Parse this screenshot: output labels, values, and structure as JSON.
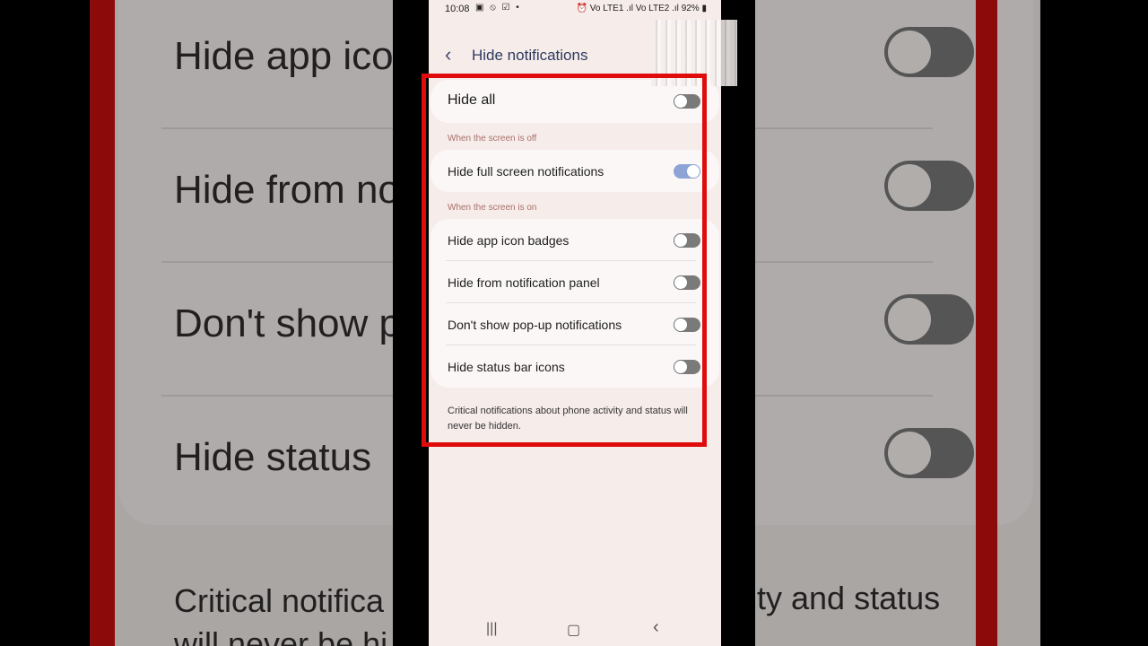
{
  "background_zoom": {
    "rows": [
      "Hide app ico",
      "Hide from no",
      "Don't show p",
      "Hide status"
    ],
    "footer_left": "Critical notifica",
    "footer_left_line2": "will never be hi",
    "footer_right": "ty and status"
  },
  "status_bar": {
    "time": "10:08",
    "left_icons": "▣ ⦸ ☑ •",
    "right_icons": "⏰ Vo LTE1 .ıl Vo LTE2 .ıl",
    "battery": "92%"
  },
  "header": {
    "back_icon": "chevron-left",
    "title": "Hide notifications"
  },
  "settings": {
    "hide_all": {
      "label": "Hide all",
      "on": false
    },
    "section_off_label": "When the screen is off",
    "full_screen": {
      "label": "Hide full screen notifications",
      "on": true
    },
    "section_on_label": "When the screen is on",
    "screen_on_items": [
      {
        "label": "Hide app icon badges",
        "on": false
      },
      {
        "label": "Hide from notification panel",
        "on": false
      },
      {
        "label": "Don't show pop-up notifications",
        "on": false
      },
      {
        "label": "Hide status bar icons",
        "on": false
      }
    ],
    "footnote": "Critical notifications about phone activity and status will never be hidden."
  },
  "nav_bar": {
    "recents": "|||",
    "home": "▢",
    "back": "‹"
  },
  "colors": {
    "highlight": "#e00c0c",
    "toggle_on": "#8ea3d6",
    "toggle_off": "#7a7a7a",
    "title": "#2d3a5e"
  }
}
